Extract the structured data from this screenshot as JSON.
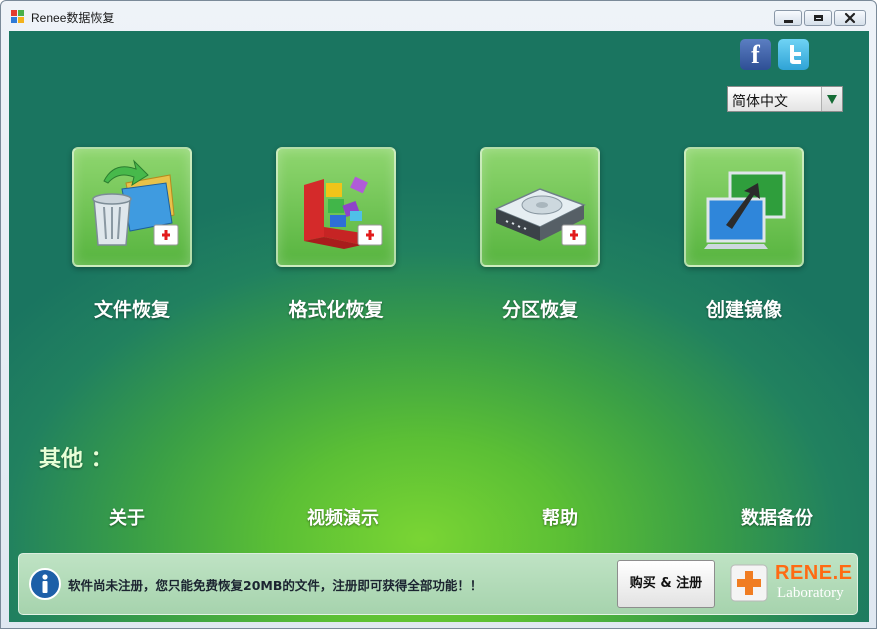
{
  "window": {
    "title": "Renee数据恢复"
  },
  "toolbar": {
    "social": [
      "facebook-icon",
      "twitter-icon"
    ],
    "language": {
      "selected": "简体中文"
    }
  },
  "features": [
    {
      "id": "file-recovery",
      "label": "文件恢复",
      "icon": "recycle-bin-folder-icon"
    },
    {
      "id": "format-recovery",
      "label": "格式化恢复",
      "icon": "blocks-icon"
    },
    {
      "id": "partition-recovery",
      "label": "分区恢复",
      "icon": "hard-drive-icon"
    },
    {
      "id": "create-image",
      "label": "创建镜像",
      "icon": "monitor-arrow-icon"
    }
  ],
  "others": {
    "title": "其他 ：",
    "links": [
      {
        "id": "about",
        "label": "关于"
      },
      {
        "id": "video-demo",
        "label": "视频演示"
      },
      {
        "id": "help",
        "label": "帮助"
      },
      {
        "id": "data-backup",
        "label": "数据备份"
      }
    ]
  },
  "status": {
    "message": "软件尚未注册，您只能免费恢复20MB的文件，注册即可获得全部功能！！",
    "buy_label": "购买 & 注册",
    "logo_brand": "RENE.E",
    "logo_sub": "Laboratory"
  },
  "colors": {
    "accent_green": "#6fd032",
    "dark_teal": "#1a7560",
    "logo_orange": "#ff6a13"
  }
}
